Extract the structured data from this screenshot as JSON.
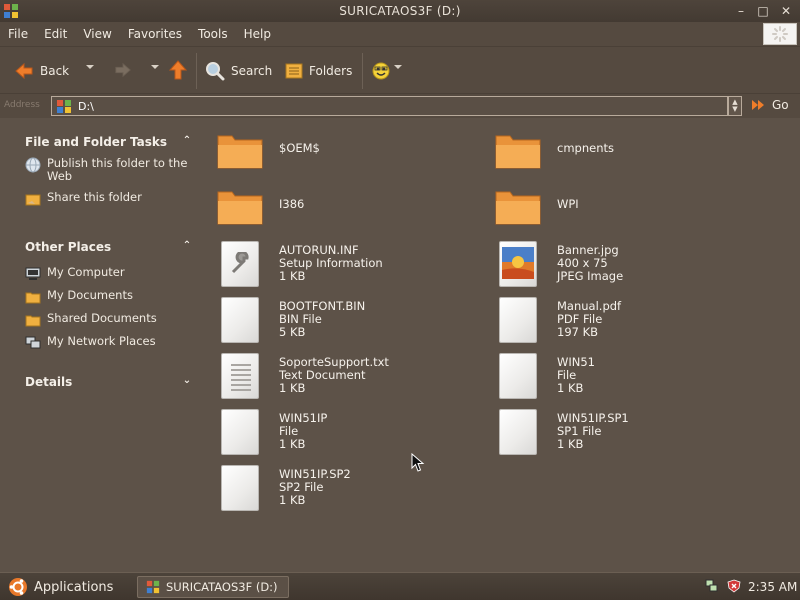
{
  "window": {
    "title": "SURICATAOS3F (D:)",
    "min_glyph": "–",
    "max_glyph": "□",
    "close_glyph": "✕"
  },
  "menu": [
    "File",
    "Edit",
    "View",
    "Favorites",
    "Tools",
    "Help"
  ],
  "toolbar": {
    "back_label": "Back",
    "search_label": "Search",
    "folders_label": "Folders"
  },
  "address": {
    "label": "Address",
    "value": "D:\\",
    "go_label": "Go"
  },
  "sidebar": {
    "file_tasks": {
      "title": "File and Folder Tasks",
      "items": [
        {
          "label": "Publish this folder to the Web",
          "icon": "globe-icon"
        },
        {
          "label": "Share this folder",
          "icon": "share-folder-icon"
        }
      ]
    },
    "other_places": {
      "title": "Other Places",
      "items": [
        {
          "label": "My Computer",
          "icon": "computer-icon"
        },
        {
          "label": "My Documents",
          "icon": "folder-icon"
        },
        {
          "label": "Shared Documents",
          "icon": "folder-icon"
        },
        {
          "label": "My Network Places",
          "icon": "network-icon"
        }
      ]
    },
    "details": {
      "title": "Details"
    }
  },
  "files": [
    {
      "name": "$OEM$",
      "type": "",
      "size": "",
      "icon": "folder-icon"
    },
    {
      "name": "cmpnents",
      "type": "",
      "size": "",
      "icon": "folder-icon"
    },
    {
      "name": "I386",
      "type": "",
      "size": "",
      "icon": "folder-icon"
    },
    {
      "name": "WPI",
      "type": "",
      "size": "",
      "icon": "folder-icon"
    },
    {
      "name": "AUTORUN.INF",
      "type": "Setup Information",
      "size": "1 KB",
      "icon": "setup-file-icon"
    },
    {
      "name": "Banner.jpg",
      "type": "400 x 75",
      "size": "JPEG Image",
      "icon": "image-file-icon"
    },
    {
      "name": "BOOTFONT.BIN",
      "type": "BIN File",
      "size": "5 KB",
      "icon": "blank-file-icon"
    },
    {
      "name": "Manual.pdf",
      "type": "PDF File",
      "size": "197 KB",
      "icon": "blank-file-icon"
    },
    {
      "name": "SoporteSupport.txt",
      "type": "Text Document",
      "size": "1 KB",
      "icon": "text-file-icon"
    },
    {
      "name": "WIN51",
      "type": "File",
      "size": "1 KB",
      "icon": "blank-file-icon"
    },
    {
      "name": "WIN51IP",
      "type": "File",
      "size": "1 KB",
      "icon": "blank-file-icon"
    },
    {
      "name": "WIN51IP.SP1",
      "type": "SP1 File",
      "size": "1 KB",
      "icon": "blank-file-icon"
    },
    {
      "name": "WIN51IP.SP2",
      "type": "SP2 File",
      "size": "1 KB",
      "icon": "blank-file-icon"
    }
  ],
  "taskbar": {
    "applications_label": "Applications",
    "window_label": "SURICATAOS3F (D:)",
    "clock": "2:35 AM"
  },
  "colors": {
    "background": "#5d5248",
    "folder": "#f0a040",
    "accent_orange": "#e8782a"
  }
}
